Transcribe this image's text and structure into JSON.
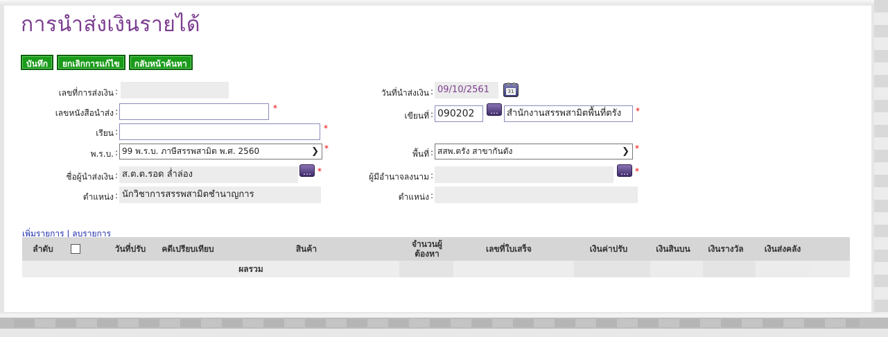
{
  "page": {
    "title": "การนำส่งเงินรายได้"
  },
  "toolbar": {
    "save": "บันทึก",
    "cancel_edit": "ยกเลิกการแก้ไข",
    "back_to_search": "กลับหน้าค้นหา"
  },
  "form": {
    "remit_no": {
      "label": "เลขที่การส่งเงิน",
      "value": ""
    },
    "letter_no": {
      "label": "เลขหนังสือนำส่ง",
      "value": ""
    },
    "to": {
      "label": "เรียน",
      "value": ""
    },
    "act": {
      "label": "พ.ร.บ.",
      "value": "99 พ.ร.บ. ภาษีสรรพสามิต พ.ศ. 2560"
    },
    "sender_name": {
      "label": "ชื่อผู้นำส่งเงิน",
      "value": "ส.ต.ต.รอด ล่ำล่อง"
    },
    "sender_position": {
      "label": "ตำแหน่ง",
      "value": "นักวิชาการสรรพสามิตชำนาญการ"
    },
    "remit_date": {
      "label": "วันที่นำส่งเงิน",
      "value": "09/10/2561"
    },
    "written_at": {
      "label": "เขียนที่",
      "code": "090202",
      "name": "สำนักงานสรรพสามิตพื้นที่ตรัง"
    },
    "area": {
      "label": "พื้นที่",
      "value": "สสพ.ตรัง สาขากันตัง"
    },
    "authorized_signer": {
      "label": "ผู้มีอำนาจลงนาม",
      "value": ""
    },
    "signer_position": {
      "label": "ตำแหน่ง",
      "value": ""
    }
  },
  "items": {
    "add_link": "เพิ่มรายการ",
    "separator": "|",
    "remove_link": "ลบรายการ",
    "columns": [
      "ลำดับ",
      "วันที่ปรับ",
      "คดีเปรียบเทียบ",
      "สินค้า",
      "จำนวนผู้ต้องหา",
      "เลขที่ใบเสร็จ",
      "เงินค่าปรับ",
      "เงินสินบน",
      "เงินรางวัล",
      "เงินส่งคลัง"
    ],
    "total_label": "ผลรวม"
  },
  "colors": {
    "title": "#7b3d8f",
    "button": "#1a9b1a",
    "link": "#1a2aa8",
    "required": "#ee0000"
  }
}
